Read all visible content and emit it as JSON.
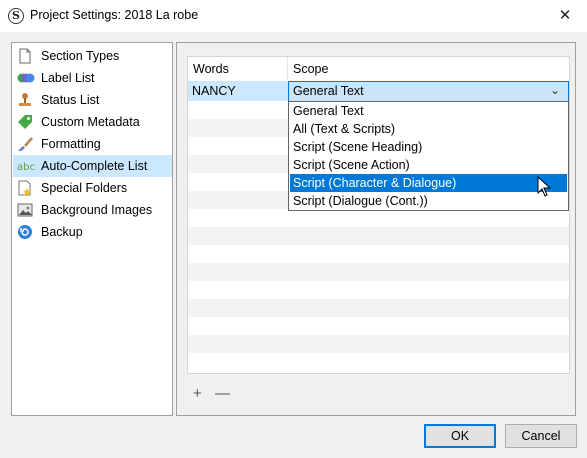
{
  "window": {
    "title": "Project Settings: 2018 La robe",
    "app_icon_letter": "S",
    "close_glyph": "✕"
  },
  "sidebar": {
    "items": [
      {
        "label": "Section Types",
        "icon": "document-icon"
      },
      {
        "label": "Label List",
        "icon": "label-icon"
      },
      {
        "label": "Status List",
        "icon": "status-stamp-icon"
      },
      {
        "label": "Custom Metadata",
        "icon": "tag-icon"
      },
      {
        "label": "Formatting",
        "icon": "brush-icon"
      },
      {
        "label": "Auto-Complete List",
        "icon": "abc-icon",
        "selected": true
      },
      {
        "label": "Special Folders",
        "icon": "special-folder-icon"
      },
      {
        "label": "Background Images",
        "icon": "image-icon"
      },
      {
        "label": "Backup",
        "icon": "backup-icon"
      }
    ]
  },
  "table": {
    "headers": {
      "words": "Words",
      "scope": "Scope"
    },
    "rows": [
      {
        "words": "NANCY",
        "scope": "General Text"
      }
    ]
  },
  "combo": {
    "value": "General Text",
    "arrow": "⌄"
  },
  "dropdown": {
    "options": [
      "General Text",
      "All (Text & Scripts)",
      "Script (Scene Heading)",
      "Script (Scene Action)",
      "Script (Character & Dialogue)",
      "Script (Dialogue (Cont.))"
    ],
    "highlighted_index": 4
  },
  "toolbar": {
    "add_label": "+",
    "remove_label": "—"
  },
  "buttons": {
    "ok": "OK",
    "cancel": "Cancel"
  },
  "colors": {
    "accent": "#0078d7",
    "selection": "#cce8ff",
    "stripe": "#f3f3f3"
  }
}
